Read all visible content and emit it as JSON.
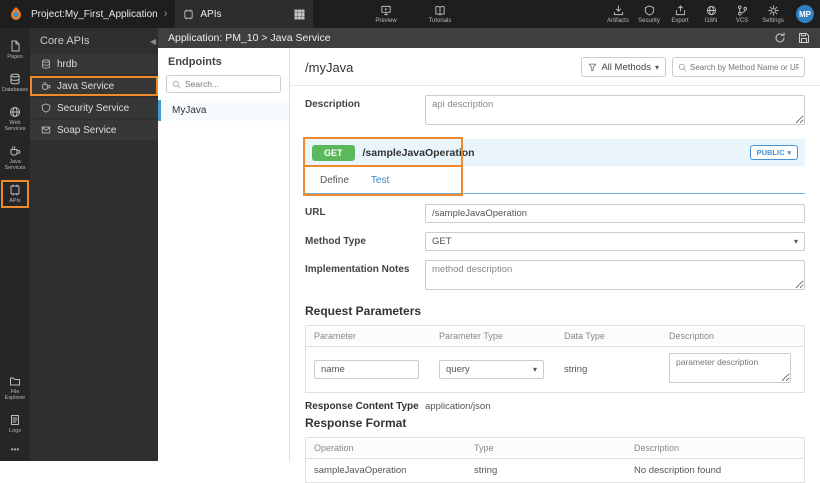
{
  "colors": {
    "annotation_orange": "#ee8a2a",
    "method_get_green": "#5cb85c",
    "link_blue": "#3a87c8",
    "avatar_blue": "#2f7fc1",
    "selection_blue": "#3f9bd5"
  },
  "topbar": {
    "project": "Project:My_First_Application",
    "apis_tab": "APIs",
    "preview": "Preview",
    "tutorials": "Tutorials",
    "artifacts": "Artifacts",
    "security": "Security",
    "export": "Export",
    "i18n": "I18N",
    "vcs": "VCS",
    "settings": "Settings",
    "avatar": "MP"
  },
  "rail": {
    "items": [
      {
        "label": "Pages"
      },
      {
        "label": "Databases"
      },
      {
        "label": "Web Services"
      },
      {
        "label": "Java Services"
      },
      {
        "label": "APIs"
      },
      {
        "label": "File Explorer"
      },
      {
        "label": "Logs"
      },
      {
        "label": "•••"
      }
    ]
  },
  "sidebar": {
    "title": "Core APIs",
    "items": [
      {
        "label": "hrdb"
      },
      {
        "label": "Java Service"
      },
      {
        "label": "Security Service"
      },
      {
        "label": "Soap Service"
      }
    ]
  },
  "appheader": {
    "breadcrumb": "Application: PM_10 > Java Service"
  },
  "endpoints": {
    "title": "Endpoints",
    "search_placeholder": "Search...",
    "items": [
      {
        "label": "MyJava"
      }
    ]
  },
  "main": {
    "title": "/myJava",
    "methods_filter": "All Methods",
    "search_placeholder": "Search by Method Name or URL...",
    "description_label": "Description",
    "description_value": "api description",
    "operation": {
      "method": "GET",
      "path": "/sampleJavaOperation",
      "visibility": "PUBLIC"
    },
    "tabs": [
      {
        "label": "Define"
      },
      {
        "label": "Test"
      }
    ],
    "form": {
      "url_label": "URL",
      "url_value": "/sampleJavaOperation",
      "method_type_label": "Method Type",
      "method_type_value": "GET",
      "implementation_notes_label": "Implementation Notes",
      "implementation_notes_value": "method description"
    },
    "request_parameters": {
      "title": "Request Parameters",
      "headers": [
        "Parameter",
        "Parameter Type",
        "Data Type",
        "Description"
      ],
      "row": {
        "parameter_value": "name",
        "parameter_type_value": "query",
        "data_type": "string",
        "description_placeholder": "parameter description"
      }
    },
    "response_content_type_label": "Response Content Type",
    "response_content_type_value": "application/json",
    "response_format": {
      "title": "Response Format",
      "headers": [
        "Operation",
        "Type",
        "Description"
      ],
      "rows": [
        {
          "operation": "sampleJavaOperation",
          "type": "string",
          "description": "No description found"
        }
      ]
    }
  }
}
